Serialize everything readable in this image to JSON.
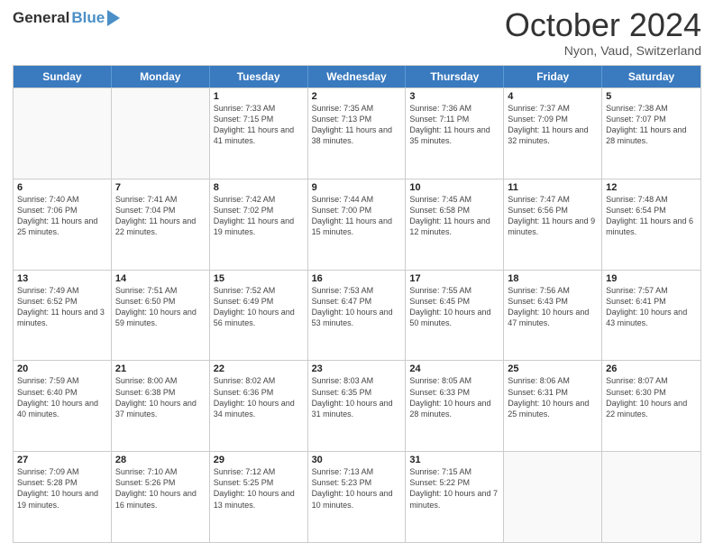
{
  "header": {
    "logo_general": "General",
    "logo_blue": "Blue",
    "month_title": "October 2024",
    "location": "Nyon, Vaud, Switzerland"
  },
  "calendar": {
    "days_of_week": [
      "Sunday",
      "Monday",
      "Tuesday",
      "Wednesday",
      "Thursday",
      "Friday",
      "Saturday"
    ],
    "weeks": [
      [
        {
          "day": "",
          "sunrise": "",
          "sunset": "",
          "daylight": "",
          "empty": true
        },
        {
          "day": "",
          "sunrise": "",
          "sunset": "",
          "daylight": "",
          "empty": true
        },
        {
          "day": "1",
          "sunrise": "Sunrise: 7:33 AM",
          "sunset": "Sunset: 7:15 PM",
          "daylight": "Daylight: 11 hours and 41 minutes.",
          "empty": false
        },
        {
          "day": "2",
          "sunrise": "Sunrise: 7:35 AM",
          "sunset": "Sunset: 7:13 PM",
          "daylight": "Daylight: 11 hours and 38 minutes.",
          "empty": false
        },
        {
          "day": "3",
          "sunrise": "Sunrise: 7:36 AM",
          "sunset": "Sunset: 7:11 PM",
          "daylight": "Daylight: 11 hours and 35 minutes.",
          "empty": false
        },
        {
          "day": "4",
          "sunrise": "Sunrise: 7:37 AM",
          "sunset": "Sunset: 7:09 PM",
          "daylight": "Daylight: 11 hours and 32 minutes.",
          "empty": false
        },
        {
          "day": "5",
          "sunrise": "Sunrise: 7:38 AM",
          "sunset": "Sunset: 7:07 PM",
          "daylight": "Daylight: 11 hours and 28 minutes.",
          "empty": false
        }
      ],
      [
        {
          "day": "6",
          "sunrise": "Sunrise: 7:40 AM",
          "sunset": "Sunset: 7:06 PM",
          "daylight": "Daylight: 11 hours and 25 minutes.",
          "empty": false
        },
        {
          "day": "7",
          "sunrise": "Sunrise: 7:41 AM",
          "sunset": "Sunset: 7:04 PM",
          "daylight": "Daylight: 11 hours and 22 minutes.",
          "empty": false
        },
        {
          "day": "8",
          "sunrise": "Sunrise: 7:42 AM",
          "sunset": "Sunset: 7:02 PM",
          "daylight": "Daylight: 11 hours and 19 minutes.",
          "empty": false
        },
        {
          "day": "9",
          "sunrise": "Sunrise: 7:44 AM",
          "sunset": "Sunset: 7:00 PM",
          "daylight": "Daylight: 11 hours and 15 minutes.",
          "empty": false
        },
        {
          "day": "10",
          "sunrise": "Sunrise: 7:45 AM",
          "sunset": "Sunset: 6:58 PM",
          "daylight": "Daylight: 11 hours and 12 minutes.",
          "empty": false
        },
        {
          "day": "11",
          "sunrise": "Sunrise: 7:47 AM",
          "sunset": "Sunset: 6:56 PM",
          "daylight": "Daylight: 11 hours and 9 minutes.",
          "empty": false
        },
        {
          "day": "12",
          "sunrise": "Sunrise: 7:48 AM",
          "sunset": "Sunset: 6:54 PM",
          "daylight": "Daylight: 11 hours and 6 minutes.",
          "empty": false
        }
      ],
      [
        {
          "day": "13",
          "sunrise": "Sunrise: 7:49 AM",
          "sunset": "Sunset: 6:52 PM",
          "daylight": "Daylight: 11 hours and 3 minutes.",
          "empty": false
        },
        {
          "day": "14",
          "sunrise": "Sunrise: 7:51 AM",
          "sunset": "Sunset: 6:50 PM",
          "daylight": "Daylight: 10 hours and 59 minutes.",
          "empty": false
        },
        {
          "day": "15",
          "sunrise": "Sunrise: 7:52 AM",
          "sunset": "Sunset: 6:49 PM",
          "daylight": "Daylight: 10 hours and 56 minutes.",
          "empty": false
        },
        {
          "day": "16",
          "sunrise": "Sunrise: 7:53 AM",
          "sunset": "Sunset: 6:47 PM",
          "daylight": "Daylight: 10 hours and 53 minutes.",
          "empty": false
        },
        {
          "day": "17",
          "sunrise": "Sunrise: 7:55 AM",
          "sunset": "Sunset: 6:45 PM",
          "daylight": "Daylight: 10 hours and 50 minutes.",
          "empty": false
        },
        {
          "day": "18",
          "sunrise": "Sunrise: 7:56 AM",
          "sunset": "Sunset: 6:43 PM",
          "daylight": "Daylight: 10 hours and 47 minutes.",
          "empty": false
        },
        {
          "day": "19",
          "sunrise": "Sunrise: 7:57 AM",
          "sunset": "Sunset: 6:41 PM",
          "daylight": "Daylight: 10 hours and 43 minutes.",
          "empty": false
        }
      ],
      [
        {
          "day": "20",
          "sunrise": "Sunrise: 7:59 AM",
          "sunset": "Sunset: 6:40 PM",
          "daylight": "Daylight: 10 hours and 40 minutes.",
          "empty": false
        },
        {
          "day": "21",
          "sunrise": "Sunrise: 8:00 AM",
          "sunset": "Sunset: 6:38 PM",
          "daylight": "Daylight: 10 hours and 37 minutes.",
          "empty": false
        },
        {
          "day": "22",
          "sunrise": "Sunrise: 8:02 AM",
          "sunset": "Sunset: 6:36 PM",
          "daylight": "Daylight: 10 hours and 34 minutes.",
          "empty": false
        },
        {
          "day": "23",
          "sunrise": "Sunrise: 8:03 AM",
          "sunset": "Sunset: 6:35 PM",
          "daylight": "Daylight: 10 hours and 31 minutes.",
          "empty": false
        },
        {
          "day": "24",
          "sunrise": "Sunrise: 8:05 AM",
          "sunset": "Sunset: 6:33 PM",
          "daylight": "Daylight: 10 hours and 28 minutes.",
          "empty": false
        },
        {
          "day": "25",
          "sunrise": "Sunrise: 8:06 AM",
          "sunset": "Sunset: 6:31 PM",
          "daylight": "Daylight: 10 hours and 25 minutes.",
          "empty": false
        },
        {
          "day": "26",
          "sunrise": "Sunrise: 8:07 AM",
          "sunset": "Sunset: 6:30 PM",
          "daylight": "Daylight: 10 hours and 22 minutes.",
          "empty": false
        }
      ],
      [
        {
          "day": "27",
          "sunrise": "Sunrise: 7:09 AM",
          "sunset": "Sunset: 5:28 PM",
          "daylight": "Daylight: 10 hours and 19 minutes.",
          "empty": false
        },
        {
          "day": "28",
          "sunrise": "Sunrise: 7:10 AM",
          "sunset": "Sunset: 5:26 PM",
          "daylight": "Daylight: 10 hours and 16 minutes.",
          "empty": false
        },
        {
          "day": "29",
          "sunrise": "Sunrise: 7:12 AM",
          "sunset": "Sunset: 5:25 PM",
          "daylight": "Daylight: 10 hours and 13 minutes.",
          "empty": false
        },
        {
          "day": "30",
          "sunrise": "Sunrise: 7:13 AM",
          "sunset": "Sunset: 5:23 PM",
          "daylight": "Daylight: 10 hours and 10 minutes.",
          "empty": false
        },
        {
          "day": "31",
          "sunrise": "Sunrise: 7:15 AM",
          "sunset": "Sunset: 5:22 PM",
          "daylight": "Daylight: 10 hours and 7 minutes.",
          "empty": false
        },
        {
          "day": "",
          "sunrise": "",
          "sunset": "",
          "daylight": "",
          "empty": true
        },
        {
          "day": "",
          "sunrise": "",
          "sunset": "",
          "daylight": "",
          "empty": true
        }
      ]
    ]
  }
}
